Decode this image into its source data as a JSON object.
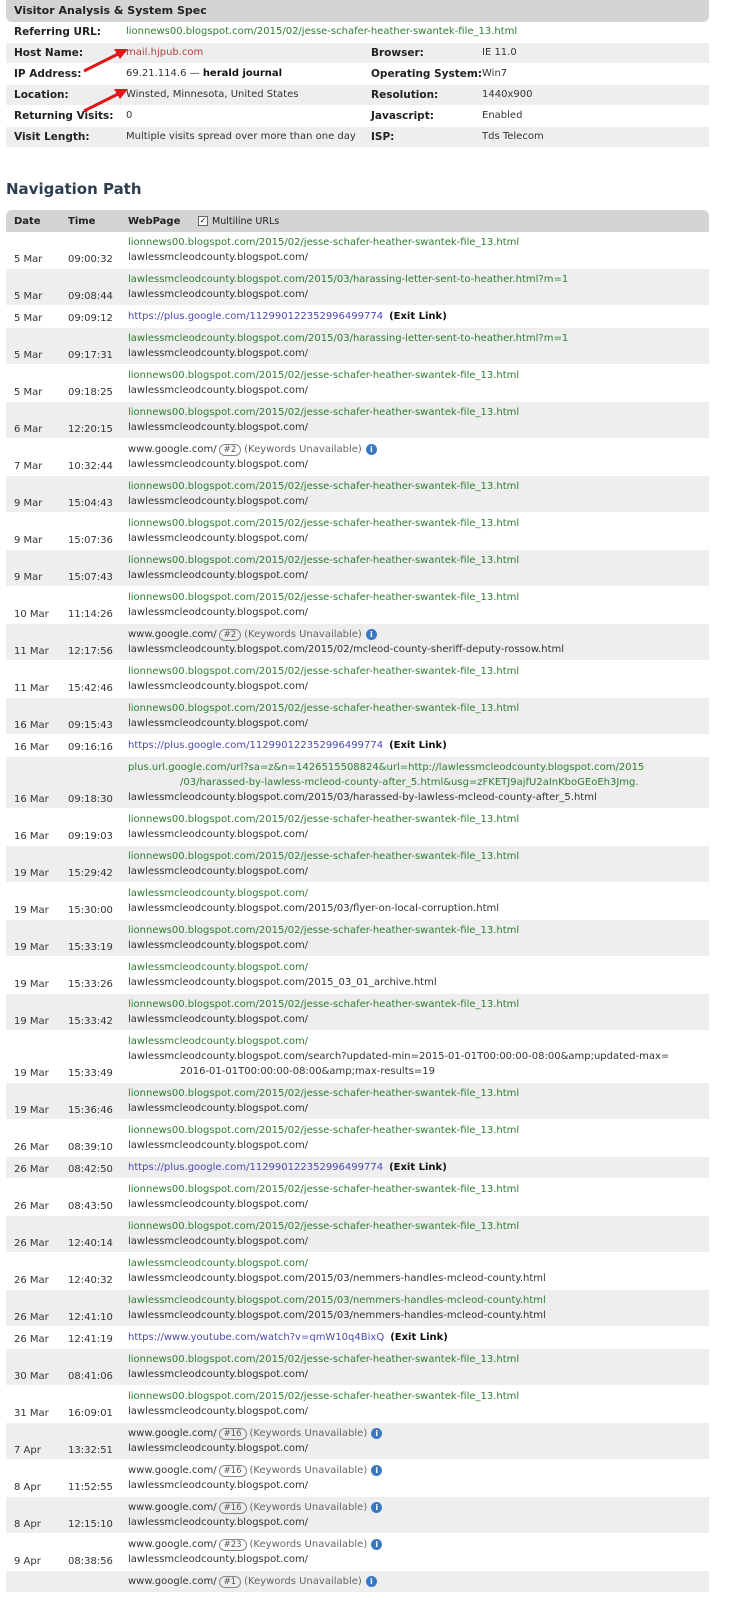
{
  "spec": {
    "title": "Visitor Analysis & System Spec",
    "referring_label": "Referring URL:",
    "referring_value": "lionnews00.blogspot.com/2015/02/jesse-schafer-heather-swantek-file_13.html",
    "host_label": "Host Name:",
    "host_value": "mail.hjpub.com",
    "browser_label": "Browser:",
    "browser_value": "IE 11.0",
    "ip_label": "IP Address:",
    "ip_value": "69.21.114.6 —",
    "ip_org": "herald journal",
    "os_label": "Operating System:",
    "os_value": "Win7",
    "location_label": "Location:",
    "location_value": "Winsted, Minnesota, United States",
    "resolution_label": "Resolution:",
    "resolution_value": "1440x900",
    "returning_label": "Returning Visits:",
    "returning_value": "0",
    "javascript_label": "Javascript:",
    "javascript_value": "Enabled",
    "visit_length_label": "Visit Length:",
    "visit_length_value": "Multiple visits spread over more than one day",
    "isp_label": "ISP:",
    "isp_value": "Tds Telecom"
  },
  "colors": {
    "annotation_arrow": "#e0161b",
    "green_link": "#2e7d32",
    "exit_link": "#4a4ab0",
    "info_icon": "#3a78c2"
  },
  "nav": {
    "title": "Navigation Path",
    "col_date": "Date",
    "col_time": "Time",
    "col_webpage": "WebPage",
    "multiline_label": "Multiline URLs",
    "multiline_checked": true,
    "exit_label": "(Exit Link)",
    "keywords_label": "(Keywords Unavailable)",
    "rows": [
      {
        "date": "5 Mar",
        "time": "09:00:32",
        "lines": [
          {
            "text": "lionnews00.blogspot.com/2015/02/jesse-schafer-heather-swantek-file_13.html",
            "style": "g"
          },
          {
            "text": "lawlessmcleodcounty.blogspot.com/",
            "style": "n"
          }
        ]
      },
      {
        "date": "5 Mar",
        "time": "09:08:44",
        "lines": [
          {
            "text": "lawlessmcleodcounty.blogspot.com/2015/03/harassing-letter-sent-to-heather.html?m=1",
            "style": "g"
          },
          {
            "text": "lawlessmcleodcounty.blogspot.com/",
            "style": "n"
          }
        ]
      },
      {
        "date": "5 Mar",
        "time": "09:09:12",
        "lines": [
          {
            "text": "https://plus.google.com/112990122352996499774",
            "style": "l",
            "exit": true
          }
        ]
      },
      {
        "date": "5 Mar",
        "time": "09:17:31",
        "lines": [
          {
            "text": "lawlessmcleodcounty.blogspot.com/2015/03/harassing-letter-sent-to-heather.html?m=1",
            "style": "g"
          },
          {
            "text": "lawlessmcleodcounty.blogspot.com/",
            "style": "n"
          }
        ]
      },
      {
        "date": "5 Mar",
        "time": "09:18:25",
        "lines": [
          {
            "text": "lionnews00.blogspot.com/2015/02/jesse-schafer-heather-swantek-file_13.html",
            "style": "g"
          },
          {
            "text": "lawlessmcleodcounty.blogspot.com/",
            "style": "n"
          }
        ]
      },
      {
        "date": "6 Mar",
        "time": "12:20:15",
        "lines": [
          {
            "text": "lionnews00.blogspot.com/2015/02/jesse-schafer-heather-swantek-file_13.html",
            "style": "g"
          },
          {
            "text": "lawlessmcleodcounty.blogspot.com/",
            "style": "n"
          }
        ]
      },
      {
        "date": "7 Mar",
        "time": "10:32:44",
        "lines": [
          {
            "text": "www.google.com/",
            "style": "n",
            "badge": "#2",
            "kw": true
          },
          {
            "text": "lawlessmcleodcounty.blogspot.com/",
            "style": "n"
          }
        ]
      },
      {
        "date": "9 Mar",
        "time": "15:04:43",
        "lines": [
          {
            "text": "lionnews00.blogspot.com/2015/02/jesse-schafer-heather-swantek-file_13.html",
            "style": "g"
          },
          {
            "text": "lawlessmcleodcounty.blogspot.com/",
            "style": "n"
          }
        ]
      },
      {
        "date": "9 Mar",
        "time": "15:07:36",
        "lines": [
          {
            "text": "lionnews00.blogspot.com/2015/02/jesse-schafer-heather-swantek-file_13.html",
            "style": "g"
          },
          {
            "text": "lawlessmcleodcounty.blogspot.com/",
            "style": "n"
          }
        ]
      },
      {
        "date": "9 Mar",
        "time": "15:07:43",
        "lines": [
          {
            "text": "lionnews00.blogspot.com/2015/02/jesse-schafer-heather-swantek-file_13.html",
            "style": "g"
          },
          {
            "text": "lawlessmcleodcounty.blogspot.com/",
            "style": "n"
          }
        ]
      },
      {
        "date": "10 Mar",
        "time": "11:14:26",
        "lines": [
          {
            "text": "lionnews00.blogspot.com/2015/02/jesse-schafer-heather-swantek-file_13.html",
            "style": "g"
          },
          {
            "text": "lawlessmcleodcounty.blogspot.com/",
            "style": "n"
          }
        ]
      },
      {
        "date": "11 Mar",
        "time": "12:17:56",
        "lines": [
          {
            "text": "www.google.com/",
            "style": "n",
            "badge": "#2",
            "kw": true
          },
          {
            "text": "lawlessmcleodcounty.blogspot.com/2015/02/mcleod-county-sheriff-deputy-rossow.html",
            "style": "n"
          }
        ]
      },
      {
        "date": "11 Mar",
        "time": "15:42:46",
        "lines": [
          {
            "text": "lionnews00.blogspot.com/2015/02/jesse-schafer-heather-swantek-file_13.html",
            "style": "g"
          },
          {
            "text": "lawlessmcleodcounty.blogspot.com/",
            "style": "n"
          }
        ]
      },
      {
        "date": "16 Mar",
        "time": "09:15:43",
        "lines": [
          {
            "text": "lionnews00.blogspot.com/2015/02/jesse-schafer-heather-swantek-file_13.html",
            "style": "g"
          },
          {
            "text": "lawlessmcleodcounty.blogspot.com/",
            "style": "n"
          }
        ]
      },
      {
        "date": "16 Mar",
        "time": "09:16:16",
        "lines": [
          {
            "text": "https://plus.google.com/112990122352996499774",
            "style": "l",
            "exit": true
          }
        ]
      },
      {
        "date": "16 Mar",
        "time": "09:18:30",
        "lines": [
          {
            "text": "plus.url.google.com/url?sa=z&n=1426515508824&url=http://lawlessmcleodcounty.blogspot.com/2015",
            "style": "g"
          },
          {
            "text": "/03/harassed-by-lawless-mcleod-county-after_5.html&usg=zFKETJ9ajfU2aInKboGEoEh3Jmg.",
            "style": "g",
            "cont": true
          },
          {
            "text": "lawlessmcleodcounty.blogspot.com/2015/03/harassed-by-lawless-mcleod-county-after_5.html",
            "style": "n"
          }
        ]
      },
      {
        "date": "16 Mar",
        "time": "09:19:03",
        "lines": [
          {
            "text": "lionnews00.blogspot.com/2015/02/jesse-schafer-heather-swantek-file_13.html",
            "style": "g"
          },
          {
            "text": "lawlessmcleodcounty.blogspot.com/",
            "style": "n"
          }
        ]
      },
      {
        "date": "19 Mar",
        "time": "15:29:42",
        "lines": [
          {
            "text": "lionnews00.blogspot.com/2015/02/jesse-schafer-heather-swantek-file_13.html",
            "style": "g"
          },
          {
            "text": "lawlessmcleodcounty.blogspot.com/",
            "style": "n"
          }
        ]
      },
      {
        "date": "19 Mar",
        "time": "15:30:00",
        "lines": [
          {
            "text": "lawlessmcleodcounty.blogspot.com/",
            "style": "g"
          },
          {
            "text": "lawlessmcleodcounty.blogspot.com/2015/03/flyer-on-local-corruption.html",
            "style": "n"
          }
        ]
      },
      {
        "date": "19 Mar",
        "time": "15:33:19",
        "lines": [
          {
            "text": "lionnews00.blogspot.com/2015/02/jesse-schafer-heather-swantek-file_13.html",
            "style": "g"
          },
          {
            "text": "lawlessmcleodcounty.blogspot.com/",
            "style": "n"
          }
        ]
      },
      {
        "date": "19 Mar",
        "time": "15:33:26",
        "lines": [
          {
            "text": "lawlessmcleodcounty.blogspot.com/",
            "style": "g"
          },
          {
            "text": "lawlessmcleodcounty.blogspot.com/2015_03_01_archive.html",
            "style": "n"
          }
        ]
      },
      {
        "date": "19 Mar",
        "time": "15:33:42",
        "lines": [
          {
            "text": "lionnews00.blogspot.com/2015/02/jesse-schafer-heather-swantek-file_13.html",
            "style": "g"
          },
          {
            "text": "lawlessmcleodcounty.blogspot.com/",
            "style": "n"
          }
        ]
      },
      {
        "date": "19 Mar",
        "time": "15:33:49",
        "lines": [
          {
            "text": "lawlessmcleodcounty.blogspot.com/",
            "style": "g"
          },
          {
            "text": "lawlessmcleodcounty.blogspot.com/search?updated-min=2015-01-01T00:00:00-08:00&amp;updated-max=",
            "style": "n"
          },
          {
            "text": "2016-01-01T00:00:00-08:00&amp;max-results=19",
            "style": "n",
            "cont": true
          }
        ]
      },
      {
        "date": "19 Mar",
        "time": "15:36:46",
        "lines": [
          {
            "text": "lionnews00.blogspot.com/2015/02/jesse-schafer-heather-swantek-file_13.html",
            "style": "g"
          },
          {
            "text": "lawlessmcleodcounty.blogspot.com/",
            "style": "n"
          }
        ]
      },
      {
        "date": "26 Mar",
        "time": "08:39:10",
        "lines": [
          {
            "text": "lionnews00.blogspot.com/2015/02/jesse-schafer-heather-swantek-file_13.html",
            "style": "g"
          },
          {
            "text": "lawlessmcleodcounty.blogspot.com/",
            "style": "n"
          }
        ]
      },
      {
        "date": "26 Mar",
        "time": "08:42:50",
        "lines": [
          {
            "text": "https://plus.google.com/112990122352996499774",
            "style": "l",
            "exit": true
          }
        ]
      },
      {
        "date": "26 Mar",
        "time": "08:43:50",
        "lines": [
          {
            "text": "lionnews00.blogspot.com/2015/02/jesse-schafer-heather-swantek-file_13.html",
            "style": "g"
          },
          {
            "text": "lawlessmcleodcounty.blogspot.com/",
            "style": "n"
          }
        ]
      },
      {
        "date": "26 Mar",
        "time": "12:40:14",
        "lines": [
          {
            "text": "lionnews00.blogspot.com/2015/02/jesse-schafer-heather-swantek-file_13.html",
            "style": "g"
          },
          {
            "text": "lawlessmcleodcounty.blogspot.com/",
            "style": "n"
          }
        ]
      },
      {
        "date": "26 Mar",
        "time": "12:40:32",
        "lines": [
          {
            "text": "lawlessmcleodcounty.blogspot.com/",
            "style": "g"
          },
          {
            "text": "lawlessmcleodcounty.blogspot.com/2015/03/nemmers-handles-mcleod-county.html",
            "style": "n"
          }
        ]
      },
      {
        "date": "26 Mar",
        "time": "12:41:10",
        "lines": [
          {
            "text": "lawlessmcleodcounty.blogspot.com/2015/03/nemmers-handles-mcleod-county.html",
            "style": "g"
          },
          {
            "text": "lawlessmcleodcounty.blogspot.com/2015/03/nemmers-handles-mcleod-county.html",
            "style": "n"
          }
        ]
      },
      {
        "date": "26 Mar",
        "time": "12:41:19",
        "lines": [
          {
            "text": "https://www.youtube.com/watch?v=qmW10q4BixQ",
            "style": "l",
            "exit": true
          }
        ]
      },
      {
        "date": "30 Mar",
        "time": "08:41:06",
        "lines": [
          {
            "text": "lionnews00.blogspot.com/2015/02/jesse-schafer-heather-swantek-file_13.html",
            "style": "g"
          },
          {
            "text": "lawlessmcleodcounty.blogspot.com/",
            "style": "n"
          }
        ]
      },
      {
        "date": "31 Mar",
        "time": "16:09:01",
        "lines": [
          {
            "text": "lionnews00.blogspot.com/2015/02/jesse-schafer-heather-swantek-file_13.html",
            "style": "g"
          },
          {
            "text": "lawlessmcleodcounty.blogspot.com/",
            "style": "n"
          }
        ]
      },
      {
        "date": "7 Apr",
        "time": "13:32:51",
        "lines": [
          {
            "text": "www.google.com/",
            "style": "n",
            "badge": "#16",
            "kw": true
          },
          {
            "text": "lawlessmcleodcounty.blogspot.com/",
            "style": "n"
          }
        ]
      },
      {
        "date": "8 Apr",
        "time": "11:52:55",
        "lines": [
          {
            "text": "www.google.com/",
            "style": "n",
            "badge": "#16",
            "kw": true
          },
          {
            "text": "lawlessmcleodcounty.blogspot.com/",
            "style": "n"
          }
        ]
      },
      {
        "date": "8 Apr",
        "time": "12:15:10",
        "lines": [
          {
            "text": "www.google.com/",
            "style": "n",
            "badge": "#16",
            "kw": true
          },
          {
            "text": "lawlessmcleodcounty.blogspot.com/",
            "style": "n"
          }
        ]
      },
      {
        "date": "9 Apr",
        "time": "08:38:56",
        "lines": [
          {
            "text": "www.google.com/",
            "style": "n",
            "badge": "#23",
            "kw": true
          },
          {
            "text": "lawlessmcleodcounty.blogspot.com/",
            "style": "n"
          }
        ]
      },
      {
        "date": "",
        "time": "",
        "lines": [
          {
            "text": "www.google.com/",
            "style": "n",
            "badge": "#1",
            "kw": true
          }
        ]
      }
    ]
  }
}
